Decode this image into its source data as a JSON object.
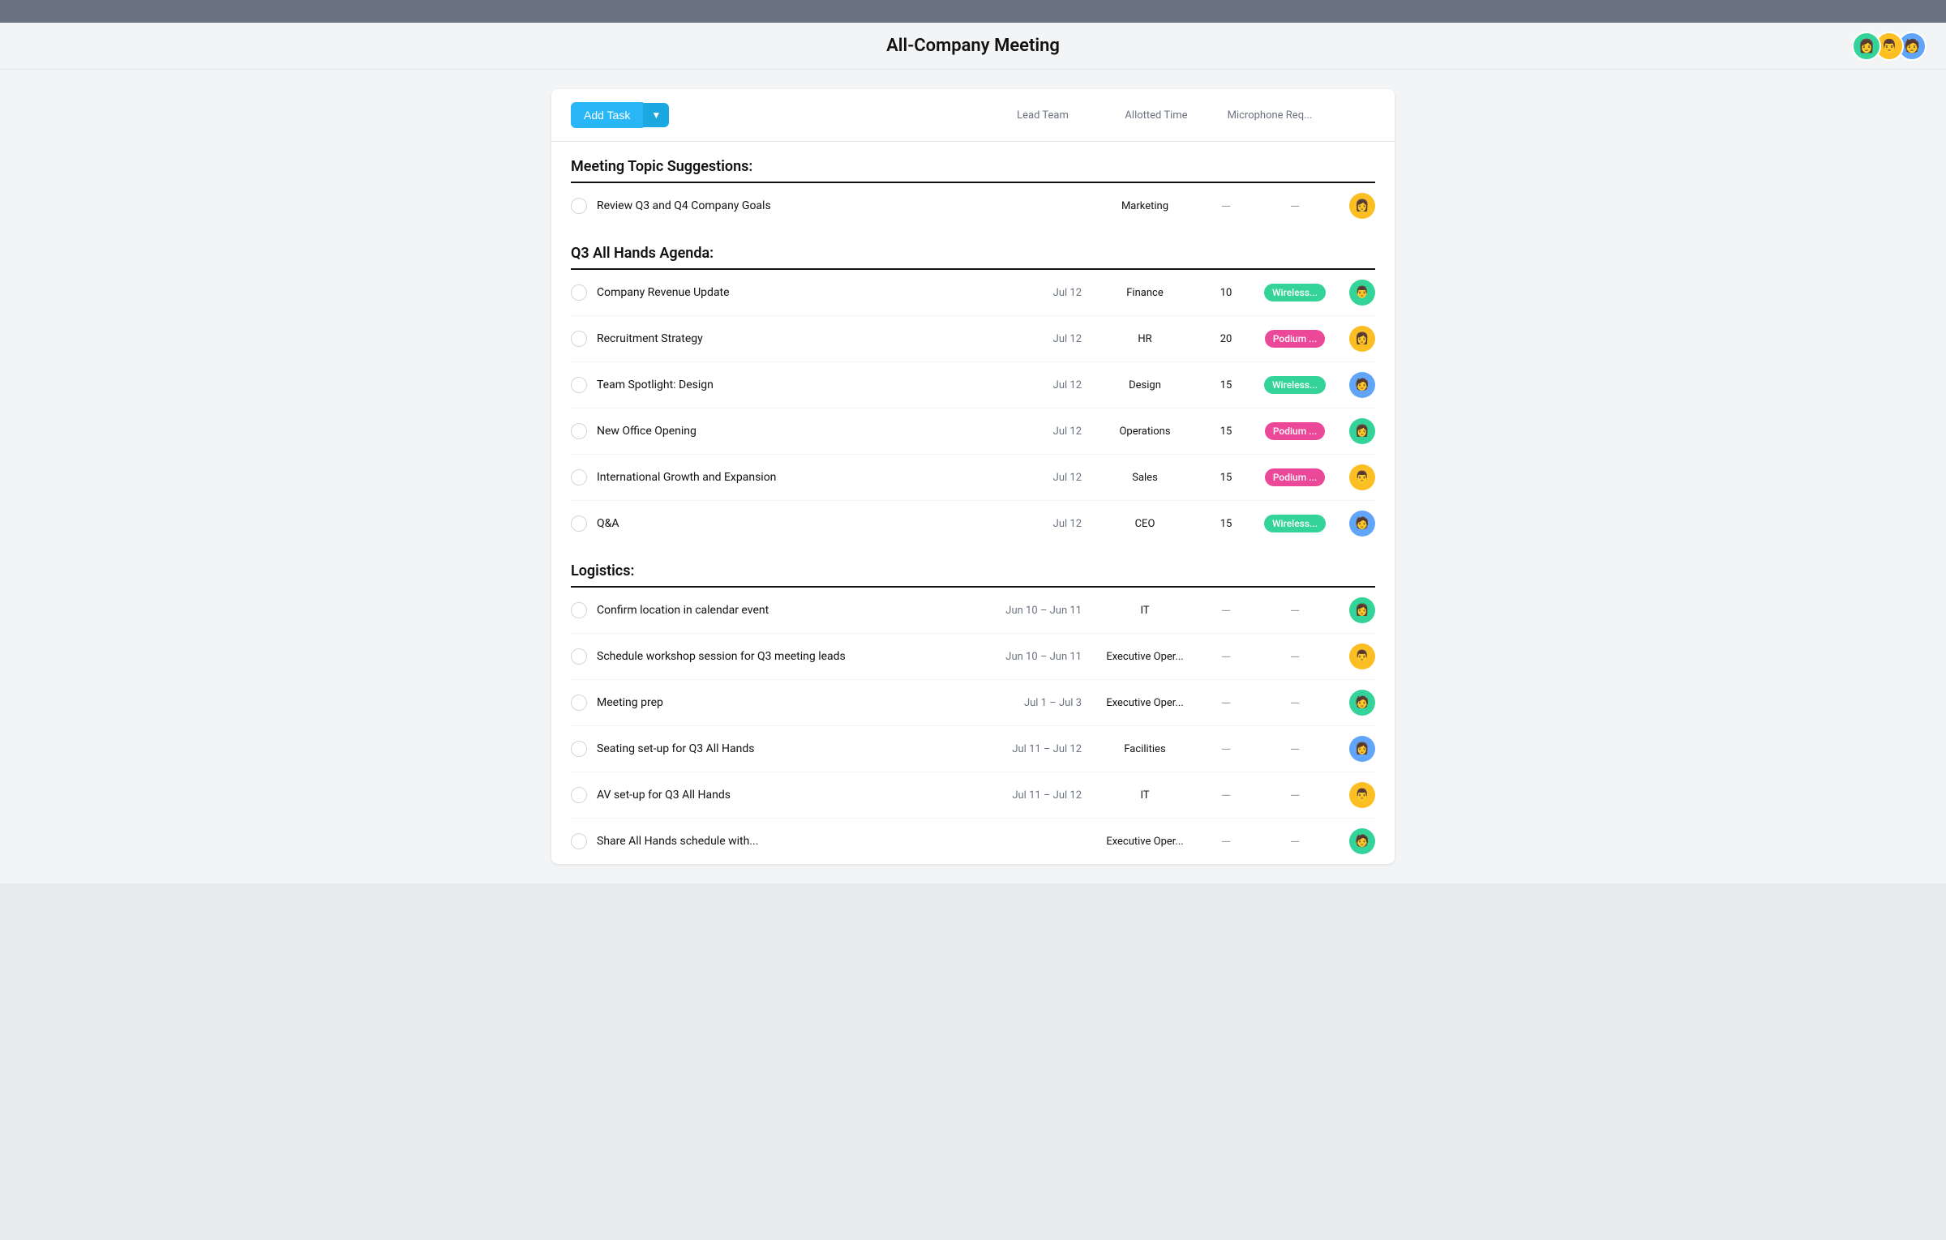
{
  "topBar": {},
  "header": {
    "title": "All-Company Meeting",
    "avatars": [
      {
        "color": "#34d399",
        "emoji": "👩",
        "label": "avatar-1"
      },
      {
        "color": "#fbbf24",
        "emoji": "👨",
        "label": "avatar-2"
      },
      {
        "color": "#60a5fa",
        "emoji": "🧑",
        "label": "avatar-3"
      }
    ]
  },
  "toolbar": {
    "addTask": "Add Task",
    "columns": {
      "leadTeam": "Lead Team",
      "allottedTime": "Allotted Time",
      "microphoneReq": "Microphone Req..."
    }
  },
  "sections": [
    {
      "title": "Meeting Topic Suggestions:",
      "tasks": [
        {
          "name": "Review Q3 and Q4 Company Goals",
          "date": "",
          "team": "Marketing",
          "time": "—",
          "mic": "—",
          "avatarColor": "#fbbf24",
          "avatarEmoji": "👩"
        }
      ]
    },
    {
      "title": "Q3 All Hands Agenda:",
      "tasks": [
        {
          "name": "Company Revenue Update",
          "date": "Jul 12",
          "team": "Finance",
          "time": "10",
          "micLabel": "Wireless...",
          "micType": "green",
          "avatarColor": "#34d399",
          "avatarEmoji": "👨"
        },
        {
          "name": "Recruitment Strategy",
          "date": "Jul 12",
          "team": "HR",
          "time": "20",
          "micLabel": "Podium ...",
          "micType": "pink",
          "avatarColor": "#fbbf24",
          "avatarEmoji": "👩"
        },
        {
          "name": "Team Spotlight: Design",
          "date": "Jul 12",
          "team": "Design",
          "time": "15",
          "micLabel": "Wireless...",
          "micType": "green",
          "avatarColor": "#60a5fa",
          "avatarEmoji": "🧑"
        },
        {
          "name": "New Office Opening",
          "date": "Jul 12",
          "team": "Operations",
          "time": "15",
          "micLabel": "Podium ...",
          "micType": "pink",
          "avatarColor": "#34d399",
          "avatarEmoji": "👩"
        },
        {
          "name": "International Growth and Expansion",
          "date": "Jul 12",
          "team": "Sales",
          "time": "15",
          "micLabel": "Podium ...",
          "micType": "pink",
          "avatarColor": "#fbbf24",
          "avatarEmoji": "👨"
        },
        {
          "name": "Q&A",
          "date": "Jul 12",
          "team": "CEO",
          "time": "15",
          "micLabel": "Wireless...",
          "micType": "green",
          "avatarColor": "#60a5fa",
          "avatarEmoji": "🧑"
        }
      ]
    },
    {
      "title": "Logistics:",
      "tasks": [
        {
          "name": "Confirm location in calendar event",
          "date": "Jun 10 – Jun 11",
          "team": "IT",
          "time": "—",
          "mic": "—",
          "avatarColor": "#34d399",
          "avatarEmoji": "👩"
        },
        {
          "name": "Schedule workshop session for Q3 meeting leads",
          "date": "Jun 10 – Jun 11",
          "team": "Executive Oper...",
          "time": "—",
          "mic": "—",
          "avatarColor": "#fbbf24",
          "avatarEmoji": "👨"
        },
        {
          "name": "Meeting prep",
          "date": "Jul 1 – Jul 3",
          "team": "Executive Oper...",
          "time": "—",
          "mic": "—",
          "avatarColor": "#34d399",
          "avatarEmoji": "🧑"
        },
        {
          "name": "Seating set-up for Q3 All Hands",
          "date": "Jul 11 – Jul 12",
          "team": "Facilities",
          "time": "—",
          "mic": "—",
          "avatarColor": "#60a5fa",
          "avatarEmoji": "👩"
        },
        {
          "name": "AV set-up for Q3 All Hands",
          "date": "Jul 11 – Jul 12",
          "team": "IT",
          "time": "—",
          "mic": "—",
          "avatarColor": "#fbbf24",
          "avatarEmoji": "👨"
        },
        {
          "name": "Share All Hands schedule with...",
          "date": "",
          "team": "Executive Oper...",
          "time": "—",
          "mic": "—",
          "avatarColor": "#34d399",
          "avatarEmoji": "🧑"
        }
      ]
    }
  ]
}
